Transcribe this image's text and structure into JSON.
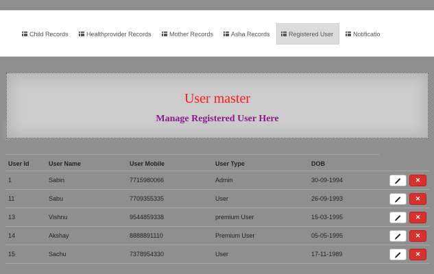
{
  "nav": {
    "items": [
      {
        "label": "Child Records",
        "icon": "list-icon"
      },
      {
        "label": "Healthprovider Records",
        "icon": "list-icon"
      },
      {
        "label": "Mother Records",
        "icon": "list-icon"
      },
      {
        "label": "Asha Records",
        "icon": "list-icon"
      },
      {
        "label": "Registered User",
        "icon": "list-icon",
        "active": true
      },
      {
        "label": "Notificatio",
        "icon": "list-icon"
      }
    ]
  },
  "hero": {
    "title": "User master",
    "subtitle": "Manage Registered User Here",
    "title_color": "#ff1a1a",
    "subtitle_color": "#8b1a8b"
  },
  "table": {
    "headers": [
      "User Id",
      "User Name",
      "User Mobile",
      "User Type",
      "DOB"
    ],
    "rows": [
      [
        "1",
        "Sabin",
        "7715980066",
        "Admin",
        "30-09-1994"
      ],
      [
        "11",
        "Sabu",
        "7709355335",
        "User",
        "26-09-1993"
      ],
      [
        "13",
        "Vishnu",
        "9544859338",
        "premium User",
        "15-03-1995"
      ],
      [
        "14",
        "Akshay",
        "8888891110",
        "Premium User",
        "05-05-1995"
      ],
      [
        "15",
        "Sachu",
        "7378954330",
        "User",
        "17-11-1989"
      ]
    ],
    "edit_icon": "pencil-icon",
    "delete_icon": "close-icon",
    "delete_color": "#d9302c"
  }
}
